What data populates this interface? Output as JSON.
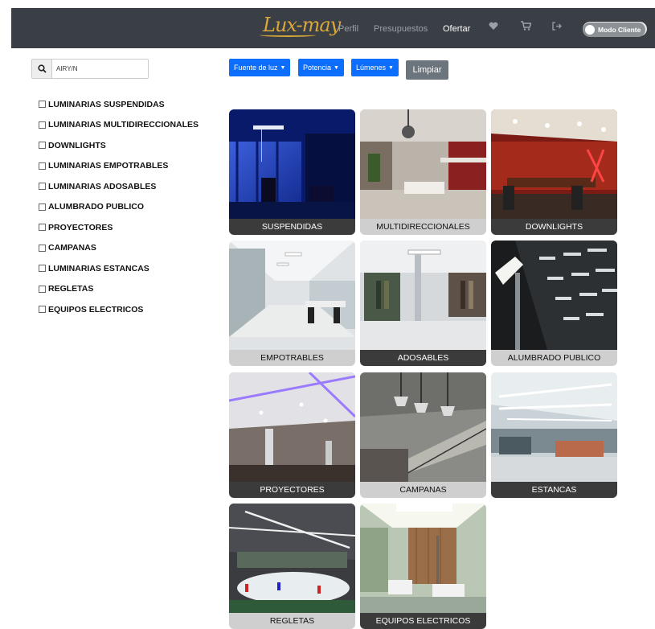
{
  "navbar": {
    "logo": "Lux-may",
    "links": [
      "Perfil",
      "Presupuestos",
      "Ofertar"
    ],
    "icons": [
      "heart-icon",
      "cart-icon",
      "logout-icon"
    ],
    "mode_toggle": "Modo Cliente"
  },
  "search": {
    "value": "AIRY/N"
  },
  "filters": {
    "fuente": "Fuente de luz",
    "potencia": "Potencia",
    "lumenes": "Lúmenes",
    "clear": "Limpiar"
  },
  "categories": [
    "LUMINARIAS SUSPENDIDAS",
    "LUMINARIAS MULTIDIRECCIONALES",
    "DOWNLIGHTS",
    "LUMINARIAS EMPOTRABLES",
    "LUMINARIAS ADOSABLES",
    "ALUMBRADO PUBLICO",
    "PROYECTORES",
    "CAMPANAS",
    "LUMINARIAS ESTANCAS",
    "REGLETAS",
    "EQUIPOS ELECTRICOS"
  ],
  "tiles": [
    "SUSPENDIDAS",
    "MULTIDIRECCIONALES",
    "DOWNLIGHTS",
    "EMPOTRABLES",
    "ADOSABLES",
    "ALUMBRADO PUBLICO",
    "PROYECTORES",
    "CAMPANAS",
    "ESTANCAS",
    "REGLETAS",
    "EQUIPOS ELECTRICOS"
  ],
  "colors": {
    "navbar": "#3a3f45",
    "primary": "#0d6efd",
    "secondary": "#6c757d",
    "logo": "#d9a73a"
  }
}
